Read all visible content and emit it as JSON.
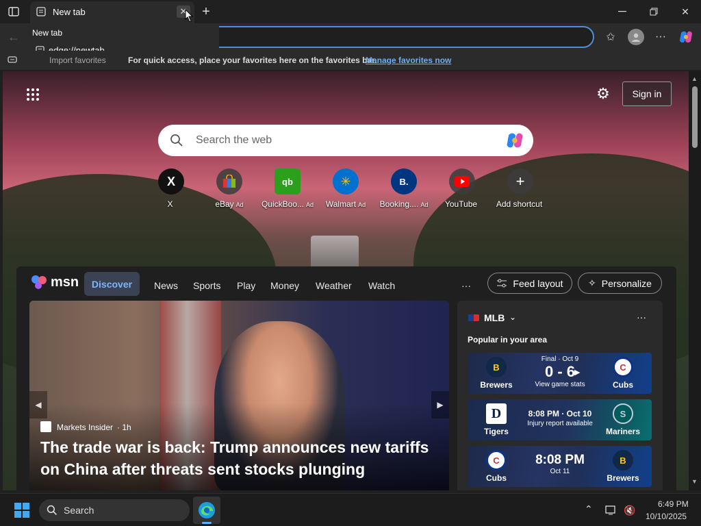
{
  "browser": {
    "tab_title": "New tab",
    "dropdown_title": "New tab",
    "dropdown_url": "edge://newtab",
    "favorites_import": "Import favorites",
    "favorites_msg": "For quick access, place your favorites here on the favorites bar.",
    "favorites_link": "Manage favorites now",
    "accent": "#4f8fd9"
  },
  "newtab": {
    "sign_in": "Sign in",
    "search_placeholder": "Search the web",
    "shortcuts": [
      {
        "label": "X",
        "icon": "X",
        "ad": ""
      },
      {
        "label": "eBay",
        "icon": "e",
        "ad": "Ad"
      },
      {
        "label": "QuickBoo...",
        "icon": "qb",
        "ad": "Ad"
      },
      {
        "label": "Walmart",
        "icon": "✳",
        "ad": "Ad"
      },
      {
        "label": "Booking....",
        "icon": "B.",
        "ad": "Ad"
      },
      {
        "label": "YouTube",
        "icon": "▶",
        "ad": ""
      },
      {
        "label": "Add shortcut",
        "icon": "+",
        "ad": ""
      }
    ]
  },
  "feed": {
    "brand": "msn",
    "nav": [
      "Discover",
      "News",
      "Sports",
      "Play",
      "Money",
      "Weather",
      "Watch"
    ],
    "more": "···",
    "feed_layout": "Feed layout",
    "personalize": "Personalize",
    "hero": {
      "source": "Markets Insider",
      "age": "· 1h",
      "headline": "The trade war is back: Trump announces new tariffs on China after threats sent stocks plunging"
    },
    "sports": {
      "league": "MLB",
      "subtitle": "Popular in your area",
      "games": [
        {
          "home": "Brewers",
          "away": "Cubs",
          "top": "Final · Oct 9",
          "center": "0 - 6",
          "bottom": "View game stats",
          "home_logo": "B",
          "away_logo": "C"
        },
        {
          "home": "Tigers",
          "away": "Mariners",
          "top": "",
          "center": "8:08 PM · Oct 10",
          "bottom": "Injury report available",
          "home_logo": "D",
          "away_logo": "S"
        },
        {
          "home": "Cubs",
          "away": "Brewers",
          "top": "",
          "center": "8:08 PM",
          "bottom": "Oct 11",
          "home_logo": "C",
          "away_logo": "B"
        }
      ]
    }
  },
  "taskbar": {
    "search": "Search",
    "time": "6:49 PM",
    "date": "10/10/2025"
  }
}
